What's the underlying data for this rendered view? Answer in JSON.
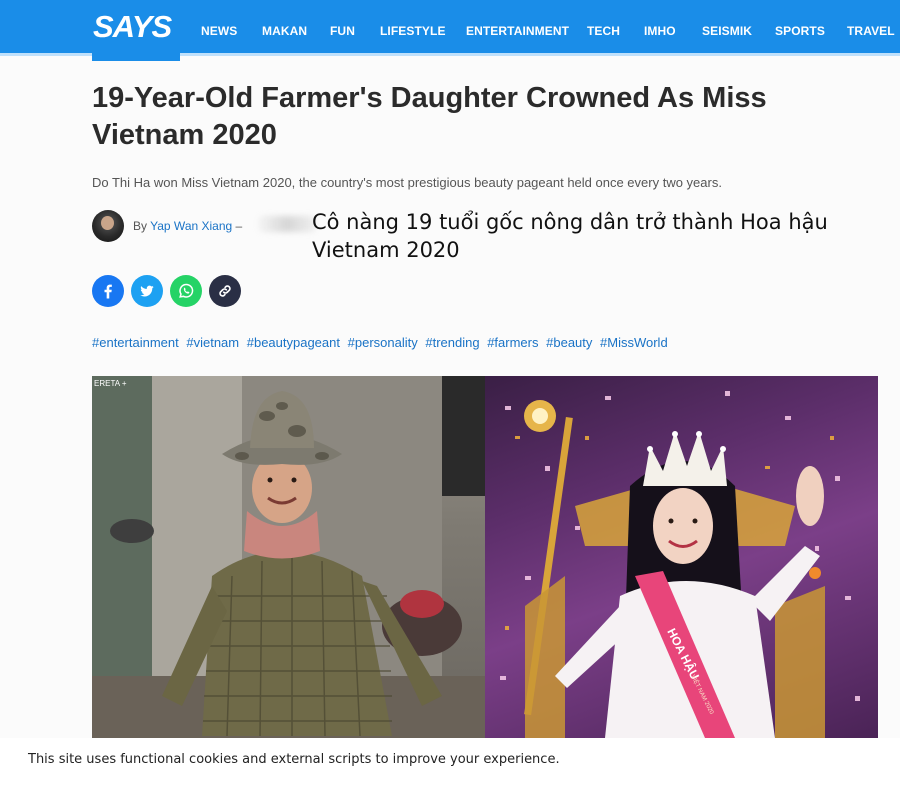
{
  "nav": {
    "logo": "SAYS",
    "items": [
      "NEWS",
      "MAKAN",
      "FUN",
      "LIFESTYLE",
      "ENTERTAINMENT",
      "TECH",
      "IMHO",
      "SEISMIK",
      "SPORTS",
      "TRAVEL"
    ],
    "background": "#1a8de8"
  },
  "article": {
    "title": "19-Year-Old Farmer's Daughter Crowned As Miss Vietnam 2020",
    "subtitle": "Do Thi Ha won Miss Vietnam 2020, the country's most prestigious beauty pageant held once every two years.",
    "byline_prefix": "By",
    "author": "Yap Wan Xiang",
    "byline_dash": "–",
    "overlay_caption": "Cô nàng 19 tuổi gốc nông dân trở thành Hoa hậu Vietnam 2020",
    "share": [
      {
        "icon": "facebook-icon",
        "color": "#1877f2"
      },
      {
        "icon": "twitter-icon",
        "color": "#1da1f2"
      },
      {
        "icon": "whatsapp-icon",
        "color": "#25d366"
      },
      {
        "icon": "link-icon",
        "color": "#2a2f45"
      }
    ],
    "hashtags": [
      "#entertainment",
      "#vietnam",
      "#beautypageant",
      "#personality",
      "#trending",
      "#farmers",
      "#beauty",
      "#MissWorld"
    ],
    "photo_left_watermark": "ERETA +",
    "sash_text": "HOA HẬU",
    "sash_small": "VIỆT NAM 2020"
  },
  "cookie": {
    "text": "This site uses functional cookies and external scripts to improve your experience."
  }
}
